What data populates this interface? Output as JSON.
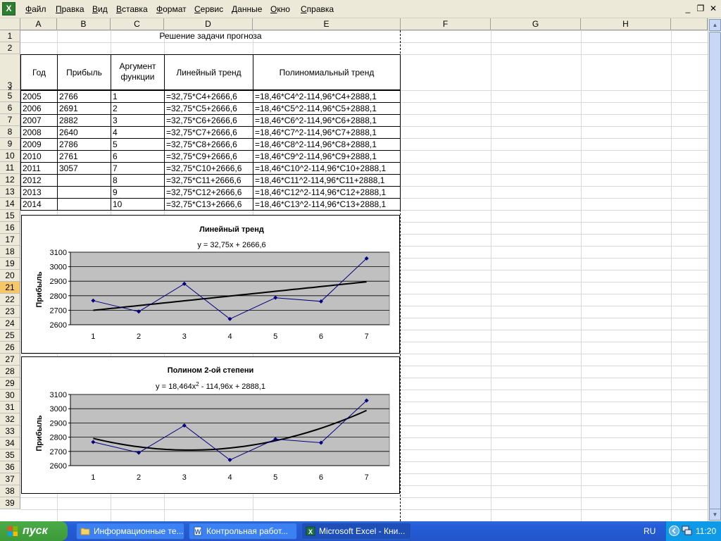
{
  "menu": {
    "items": [
      "Файл",
      "Правка",
      "Вид",
      "Вставка",
      "Формат",
      "Сервис",
      "Данные",
      "Окно",
      "Справка"
    ],
    "minimize": "_",
    "restore": "❐",
    "close": "✕"
  },
  "columns": [
    "A",
    "B",
    "C",
    "D",
    "E",
    "F",
    "G",
    "H"
  ],
  "rows": [
    "1",
    "2",
    "3",
    "4",
    "5",
    "6",
    "7",
    "8",
    "9",
    "10",
    "11",
    "12",
    "13",
    "14",
    "15",
    "16",
    "17",
    "18",
    "19",
    "20",
    "21",
    "22",
    "23",
    "24",
    "25",
    "26",
    "27",
    "28",
    "29",
    "30",
    "31",
    "32",
    "33",
    "34",
    "35",
    "36",
    "37",
    "38",
    "39"
  ],
  "sheet": {
    "title": "Решение задачи прогноза",
    "headers": {
      "year": "Год",
      "profit": "Прибыль",
      "argument_line1": "Аргумент",
      "argument_line2": "функции",
      "linear": "Линейный тренд",
      "poly": "Полиномиальный тренд"
    },
    "data_rows": [
      {
        "year": "2005",
        "profit": "2766",
        "arg": "1",
        "lin": "=32,75*C4+2666,6",
        "poly": "=18,46*C4^2-114,96*C4+2888,1"
      },
      {
        "year": "2006",
        "profit": "2691",
        "arg": "2",
        "lin": "=32,75*C5+2666,6",
        "poly": "=18,46*C5^2-114,96*C5+2888,1"
      },
      {
        "year": "2007",
        "profit": "2882",
        "arg": "3",
        "lin": "=32,75*C6+2666,6",
        "poly": "=18,46*C6^2-114,96*C6+2888,1"
      },
      {
        "year": "2008",
        "profit": "2640",
        "arg": "4",
        "lin": "=32,75*C7+2666,6",
        "poly": "=18,46*C7^2-114,96*C7+2888,1"
      },
      {
        "year": "2009",
        "profit": "2786",
        "arg": "5",
        "lin": "=32,75*C8+2666,6",
        "poly": "=18,46*C8^2-114,96*C8+2888,1"
      },
      {
        "year": "2010",
        "profit": "2761",
        "arg": "6",
        "lin": "=32,75*C9+2666,6",
        "poly": "=18,46*C9^2-114,96*C9+2888,1"
      },
      {
        "year": "2011",
        "profit": "3057",
        "arg": "7",
        "lin": "=32,75*C10+2666,6",
        "poly": "=18,46*C10^2-114,96*C10+2888,1"
      },
      {
        "year": "2012",
        "profit": "",
        "arg": "8",
        "lin": "=32,75*C11+2666,6",
        "poly": "=18,46*C11^2-114,96*C11+2888,1"
      },
      {
        "year": "2013",
        "profit": "",
        "arg": "9",
        "lin": "=32,75*C12+2666,6",
        "poly": "=18,46*C12^2-114,96*C12+2888,1"
      },
      {
        "year": "2014",
        "profit": "",
        "arg": "10",
        "lin": "=32,75*C13+2666,6",
        "poly": "=18,46*C13^2-114,96*C13+2888,1"
      }
    ]
  },
  "chart_data": [
    {
      "type": "line",
      "title": "Линейный тренд",
      "equation": "y = 32,75x + 2666,6",
      "xlabel": "",
      "ylabel": "Прибыль",
      "x": [
        1,
        2,
        3,
        4,
        5,
        6,
        7
      ],
      "series": [
        {
          "values": [
            2766,
            2691,
            2882,
            2640,
            2786,
            2761,
            3057
          ]
        }
      ],
      "trend": {
        "kind": "linear",
        "a": 32.75,
        "b": 2666.6
      },
      "ylim": [
        2600,
        3100
      ],
      "yticks": [
        2600,
        2700,
        2800,
        2900,
        3000,
        3100
      ],
      "grid": true,
      "plot_bg": "#c0c0c0",
      "series_color": "#000080"
    },
    {
      "type": "line",
      "title": "Полином 2-ой степени",
      "equation_main": "y = 18,464x",
      "equation_sup": "2",
      "equation_rest": " - 114,96x + 2888,1",
      "xlabel": "",
      "ylabel": "Прибыль",
      "x": [
        1,
        2,
        3,
        4,
        5,
        6,
        7
      ],
      "series": [
        {
          "values": [
            2766,
            2691,
            2882,
            2640,
            2786,
            2761,
            3057
          ]
        }
      ],
      "trend": {
        "kind": "poly2",
        "a": 18.464,
        "b": -114.96,
        "c": 2888.1
      },
      "ylim": [
        2600,
        3100
      ],
      "yticks": [
        2600,
        2700,
        2800,
        2900,
        3000,
        3100
      ],
      "grid": true,
      "plot_bg": "#c0c0c0",
      "series_color": "#000080"
    }
  ],
  "taskbar": {
    "start": "пуск",
    "tasks": [
      "Информационные те...",
      "Контрольная работ...",
      "Microsoft Excel - Кни..."
    ],
    "lang": "RU",
    "clock": "11:20"
  }
}
